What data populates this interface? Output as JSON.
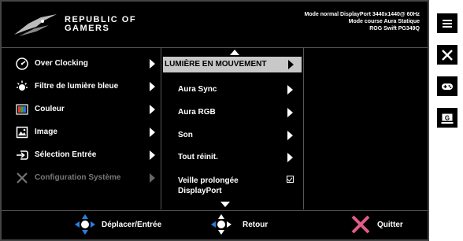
{
  "header": {
    "brand_line1": "REPUBLIC OF",
    "brand_line2": "GAMERS",
    "info_line1": "Mode normal DisplayPort 3440x1440@ 60Hz",
    "info_line2": "Mode course Aura Statique",
    "info_line3": "ROG Swift PG349Q"
  },
  "main_menu": [
    {
      "label": "Over Clocking",
      "icon": "speedometer-icon"
    },
    {
      "label": "Filtre de lumière bleue",
      "icon": "sun-icon"
    },
    {
      "label": "Couleur",
      "icon": "color-palette-icon"
    },
    {
      "label": "Image",
      "icon": "image-icon"
    },
    {
      "label": "Sélection Entrée",
      "icon": "input-icon"
    },
    {
      "label": "Configuration Système",
      "icon": "wrench-icon",
      "disabled": true
    }
  ],
  "sub_menu": [
    {
      "label": "LUMIÈRE EN MOUVEMENT",
      "selected": true
    },
    {
      "label": "Aura Sync"
    },
    {
      "label": "Aura RGB"
    },
    {
      "label": "Son"
    },
    {
      "label": "Tout réinit."
    },
    {
      "label_line1": "Veille prolongée",
      "label_line2": "DisplayPort",
      "checked": true
    }
  ],
  "footer": {
    "move_label": "Déplacer/Entrée",
    "back_label": "Retour",
    "exit_label": "Quitter"
  },
  "side_buttons": [
    "menu-icon",
    "close-icon",
    "gamepad-icon",
    "gameplus-icon"
  ],
  "side_g_label": "G",
  "colors": {
    "background": "#000000",
    "selected": "#c8c8c8",
    "accent_blue": "#2a7de1",
    "exit_pink": "#e45a8a"
  }
}
